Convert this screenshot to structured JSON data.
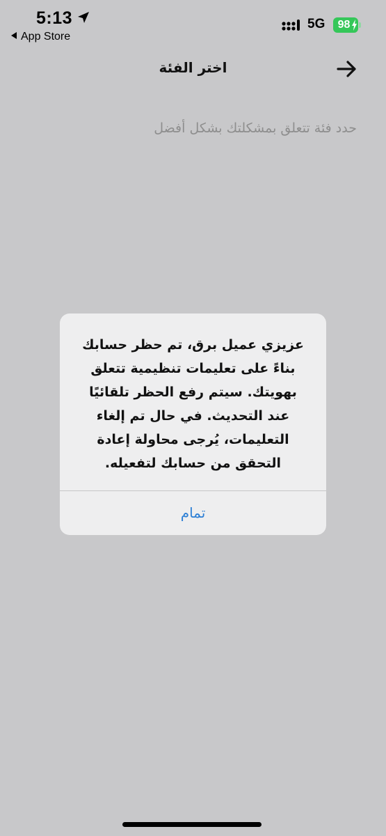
{
  "status_bar": {
    "time": "5:13",
    "back_app_label": "App Store",
    "network": "5G",
    "battery_level": "98",
    "icons": [
      "location-icon",
      "signal-icon",
      "battery-icon",
      "bolt-icon"
    ],
    "battery_color": "#35c759"
  },
  "nav": {
    "title": "اختر الفئة",
    "back_icon": "arrow-right-icon"
  },
  "main": {
    "subtitle": "حدد فئة تتعلق بمشكلتك بشكل أفضل"
  },
  "alert": {
    "lines": [
      "عزيزي عميل برق، تم حظر حسابك",
      "بناءً على تعليمات تنظيمية تتعلق",
      "بهويتك. سيتم رفع الحظر تلقائيًا",
      "عند التحديث. في حال تم إلغاء",
      "التعليمات، يُرجى محاولة إعادة",
      "التحقق من حسابك لتفعيله."
    ],
    "button_label": "تمام",
    "button_color": "#2d7fd5"
  }
}
